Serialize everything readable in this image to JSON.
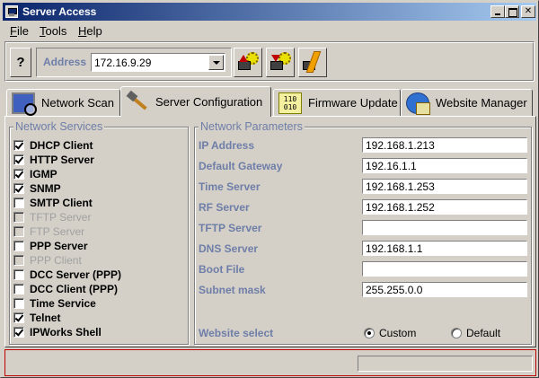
{
  "window": {
    "title": "Server Access"
  },
  "menu": {
    "file": "File",
    "tools": "Tools",
    "help": "Help"
  },
  "toolbar": {
    "help_label": "?",
    "address_label": "Address",
    "address_value": "172.16.9.29"
  },
  "tabs": [
    {
      "label": "Network Scan",
      "icon": "monitor-magnifier-icon",
      "active": false
    },
    {
      "label": "Server Configuration",
      "icon": "hammer-tools-icon",
      "active": true
    },
    {
      "label": "Firmware Update",
      "icon": "binary-chip-icon",
      "active": false
    },
    {
      "label": "Website Manager",
      "icon": "globe-computer-icon",
      "active": false
    }
  ],
  "services": {
    "title": "Network Services",
    "items": [
      {
        "label": "DHCP Client",
        "checked": true,
        "enabled": true
      },
      {
        "label": "HTTP Server",
        "checked": true,
        "enabled": true
      },
      {
        "label": "IGMP",
        "checked": true,
        "enabled": true
      },
      {
        "label": "SNMP",
        "checked": true,
        "enabled": true
      },
      {
        "label": "SMTP Client",
        "checked": false,
        "enabled": true
      },
      {
        "label": "TFTP Server",
        "checked": false,
        "enabled": false
      },
      {
        "label": "FTP Server",
        "checked": false,
        "enabled": false
      },
      {
        "label": "PPP Server",
        "checked": false,
        "enabled": true
      },
      {
        "label": "PPP Client",
        "checked": false,
        "enabled": false
      },
      {
        "label": "DCC Server (PPP)",
        "checked": false,
        "enabled": true
      },
      {
        "label": "DCC Client (PPP)",
        "checked": false,
        "enabled": true
      },
      {
        "label": "Time Service",
        "checked": false,
        "enabled": true
      },
      {
        "label": "Telnet",
        "checked": true,
        "enabled": true
      },
      {
        "label": "IPWorks Shell",
        "checked": true,
        "enabled": true
      }
    ]
  },
  "params": {
    "title": "Network Parameters",
    "fields": [
      {
        "label": "IP Address",
        "value": "192.168.1.213"
      },
      {
        "label": "Default Gateway",
        "value": "192.16.1.1"
      },
      {
        "label": "Time Server",
        "value": "192.168.1.253"
      },
      {
        "label": "RF Server",
        "value": "192.168.1.252"
      },
      {
        "label": "TFTP Server",
        "value": ""
      },
      {
        "label": "DNS Server",
        "value": "192.168.1.1"
      },
      {
        "label": "Boot File",
        "value": ""
      },
      {
        "label": "Subnet mask",
        "value": "255.255.0.0"
      }
    ],
    "website_select": {
      "label": "Website select",
      "options": [
        {
          "label": "Custom",
          "selected": true
        },
        {
          "label": "Default",
          "selected": false
        }
      ]
    }
  },
  "status": {
    "text": ""
  }
}
